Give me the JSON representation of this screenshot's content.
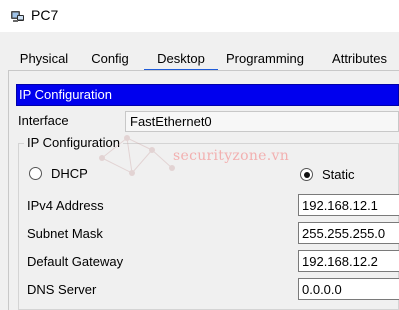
{
  "window": {
    "title": "PC7",
    "icon": "pc-device-icon"
  },
  "tabs": [
    {
      "label": "Physical"
    },
    {
      "label": "Config"
    },
    {
      "label": "Desktop"
    },
    {
      "label": "Programming"
    },
    {
      "label": "Attributes"
    }
  ],
  "active_tab": "Desktop",
  "section": {
    "title": "IP Configuration"
  },
  "interface": {
    "label": "Interface",
    "value": "FastEthernet0"
  },
  "ip_group": {
    "title": "IP Configuration",
    "dhcp_label": "DHCP",
    "static_label": "Static",
    "selected": "Static"
  },
  "fields": {
    "ipv4": {
      "label": "IPv4 Address",
      "value": "192.168.12.1"
    },
    "subnet": {
      "label": "Subnet Mask",
      "value": "255.255.255.0"
    },
    "gateway": {
      "label": "Default Gateway",
      "value": "192.168.12.2"
    },
    "dns": {
      "label": "DNS Server",
      "value": "0.0.0.0"
    }
  },
  "watermark": {
    "text": "securityzone.vn"
  },
  "colors": {
    "section_header_bg": "#0000ee",
    "active_tab_underline": "#1f5bd8"
  }
}
